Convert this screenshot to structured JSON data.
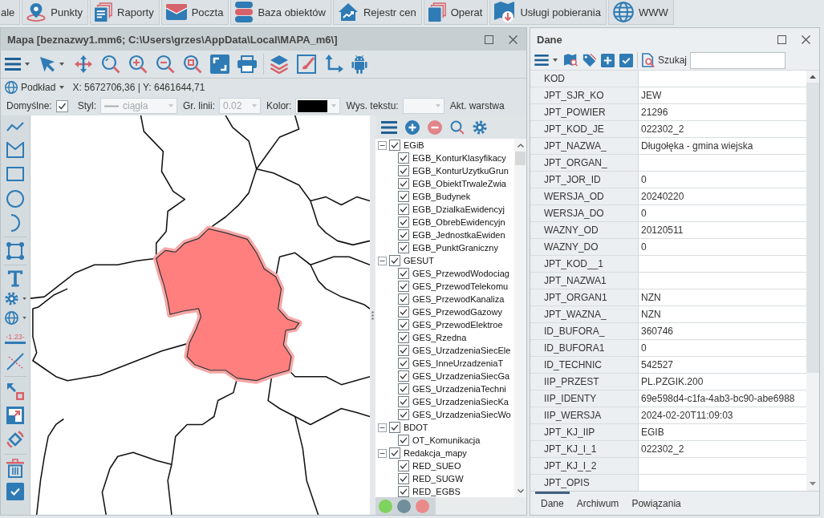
{
  "ribbon": [
    {
      "label": "ale"
    },
    {
      "label": "Punkty"
    },
    {
      "label": "Raporty"
    },
    {
      "label": "Poczta"
    },
    {
      "label": "Baza obiektów"
    },
    {
      "label": "Rejestr cen"
    },
    {
      "label": "Operat"
    },
    {
      "label": "Usługi pobierania"
    },
    {
      "label": "WWW"
    }
  ],
  "map_window": {
    "title": "Mapa [beznazwy1.mm6; C:\\Users\\grzes\\AppData\\Local\\MAPA_m6\\]",
    "basemap": "Podkład",
    "coordinates": "X: 5672706,36 | Y: 6461644,71",
    "options": [
      {
        "kind": "checkbox",
        "label": "Domyślne:",
        "checked": true
      },
      {
        "kind": "line-style",
        "label": "Styl:",
        "value": "ciągła",
        "disabled": true
      },
      {
        "kind": "select",
        "label": "Gr. linii:",
        "value": "0.02",
        "disabled": true
      },
      {
        "kind": "color",
        "label": "Kolor:",
        "color": "#000000",
        "disabled": true
      },
      {
        "kind": "select",
        "label": "Wys. tekstu:",
        "disabled": true
      },
      {
        "kind": "text",
        "label": "Akt. warstwa"
      }
    ],
    "dimension_tool": "-1.23-"
  },
  "layers": {
    "groups": [
      {
        "name": "EGiB",
        "checked": true,
        "expanded": true,
        "children": [
          {
            "name": "EGB_KonturKlasyfikacy",
            "checked": true
          },
          {
            "name": "EGB_KonturUzytkuGrun",
            "checked": true
          },
          {
            "name": "EGB_ObiektTrwaleZwia",
            "checked": true
          },
          {
            "name": "EGB_Budynek",
            "checked": true
          },
          {
            "name": "EGB_DzialkaEwidencyj",
            "checked": true
          },
          {
            "name": "EGB_ObrebEwidencyjn",
            "checked": true
          },
          {
            "name": "EGB_JednostkaEwiden",
            "checked": true
          },
          {
            "name": "EGB_PunktGraniczny",
            "checked": true
          }
        ]
      },
      {
        "name": "GESUT",
        "checked": true,
        "expanded": true,
        "children": [
          {
            "name": "GES_PrzewodWodociag",
            "checked": true
          },
          {
            "name": "GES_PrzewodTelekomu",
            "checked": true
          },
          {
            "name": "GES_PrzewodKanaliza",
            "checked": true
          },
          {
            "name": "GES_PrzewodGazowy",
            "checked": true
          },
          {
            "name": "GES_PrzewodElektroe",
            "checked": true
          },
          {
            "name": "GES_Rzedna",
            "checked": true
          },
          {
            "name": "GES_UrzadzeniaSiecEle",
            "checked": true
          },
          {
            "name": "GES_InneUrzadzeniaT",
            "checked": true
          },
          {
            "name": "GES_UrzadzeniaSiecGa",
            "checked": true
          },
          {
            "name": "GES_UrzadzeniaTechni",
            "checked": true
          },
          {
            "name": "GES_UrzadzeniaSiecKa",
            "checked": true
          },
          {
            "name": "GES_UrzadzeniaSiecWo",
            "checked": true
          }
        ]
      },
      {
        "name": "BDOT",
        "checked": true,
        "expanded": true,
        "children": [
          {
            "name": "OT_Komunikacja",
            "checked": true
          }
        ]
      },
      {
        "name": "Redakcja_mapy",
        "checked": true,
        "expanded": true,
        "children": [
          {
            "name": "RED_SUEO",
            "checked": true
          },
          {
            "name": "RED_SUGW",
            "checked": true
          },
          {
            "name": "RED_EGBS",
            "checked": true
          }
        ]
      }
    ],
    "color_buttons": [
      {
        "color": "#7fd35f"
      },
      {
        "color": "#6f8f9b"
      },
      {
        "color": "#ea8a8a"
      }
    ]
  },
  "data_window": {
    "title": "Dane",
    "search_label": "Szukaj",
    "rows": [
      {
        "name": "KOD"
      },
      {
        "name": "JPT_SJR_KO",
        "value": "JEW"
      },
      {
        "name": "JPT_POWIER",
        "value": "21296"
      },
      {
        "name": "JPT_KOD_JE",
        "value": "022302_2"
      },
      {
        "name": "JPT_NAZWA_",
        "value": "Długołęka - gmina wiejska"
      },
      {
        "name": "JPT_ORGAN_"
      },
      {
        "name": "JPT_JOR_ID",
        "value": "0"
      },
      {
        "name": "WERSJA_OD",
        "value": "20240220"
      },
      {
        "name": "WERSJA_DO",
        "value": "0"
      },
      {
        "name": "WAZNY_OD",
        "value": "20120511"
      },
      {
        "name": "WAZNY_DO",
        "value": "0"
      },
      {
        "name": "JPT_KOD__1"
      },
      {
        "name": "JPT_NAZWA1"
      },
      {
        "name": "JPT_ORGAN1",
        "value": "NZN"
      },
      {
        "name": "JPT_WAZNA_",
        "value": "NZN"
      },
      {
        "name": "ID_BUFORA_",
        "value": "360746"
      },
      {
        "name": "ID_BUFORA1",
        "value": "0"
      },
      {
        "name": "ID_TECHNIC",
        "value": "542527"
      },
      {
        "name": "IIP_PRZEST",
        "value": "PL.PZGIK.200"
      },
      {
        "name": "IIP_IDENTY",
        "value": "69e598d4-c1fa-4ab3-bc90-abe6988"
      },
      {
        "name": "IIP_WERSJA",
        "value": "2024-02-20T11:09:03"
      },
      {
        "name": "JPT_KJ_IIP",
        "value": "EGIB"
      },
      {
        "name": "JPT_KJ_I_1",
        "value": "022302_2"
      },
      {
        "name": "JPT_KJ_I_2"
      },
      {
        "name": "JPT_OPIS"
      }
    ],
    "tabs": [
      {
        "label": "Dane",
        "selected": true
      },
      {
        "label": "Archiwum",
        "selected": false
      },
      {
        "label": "Powiązania",
        "selected": false
      }
    ]
  }
}
